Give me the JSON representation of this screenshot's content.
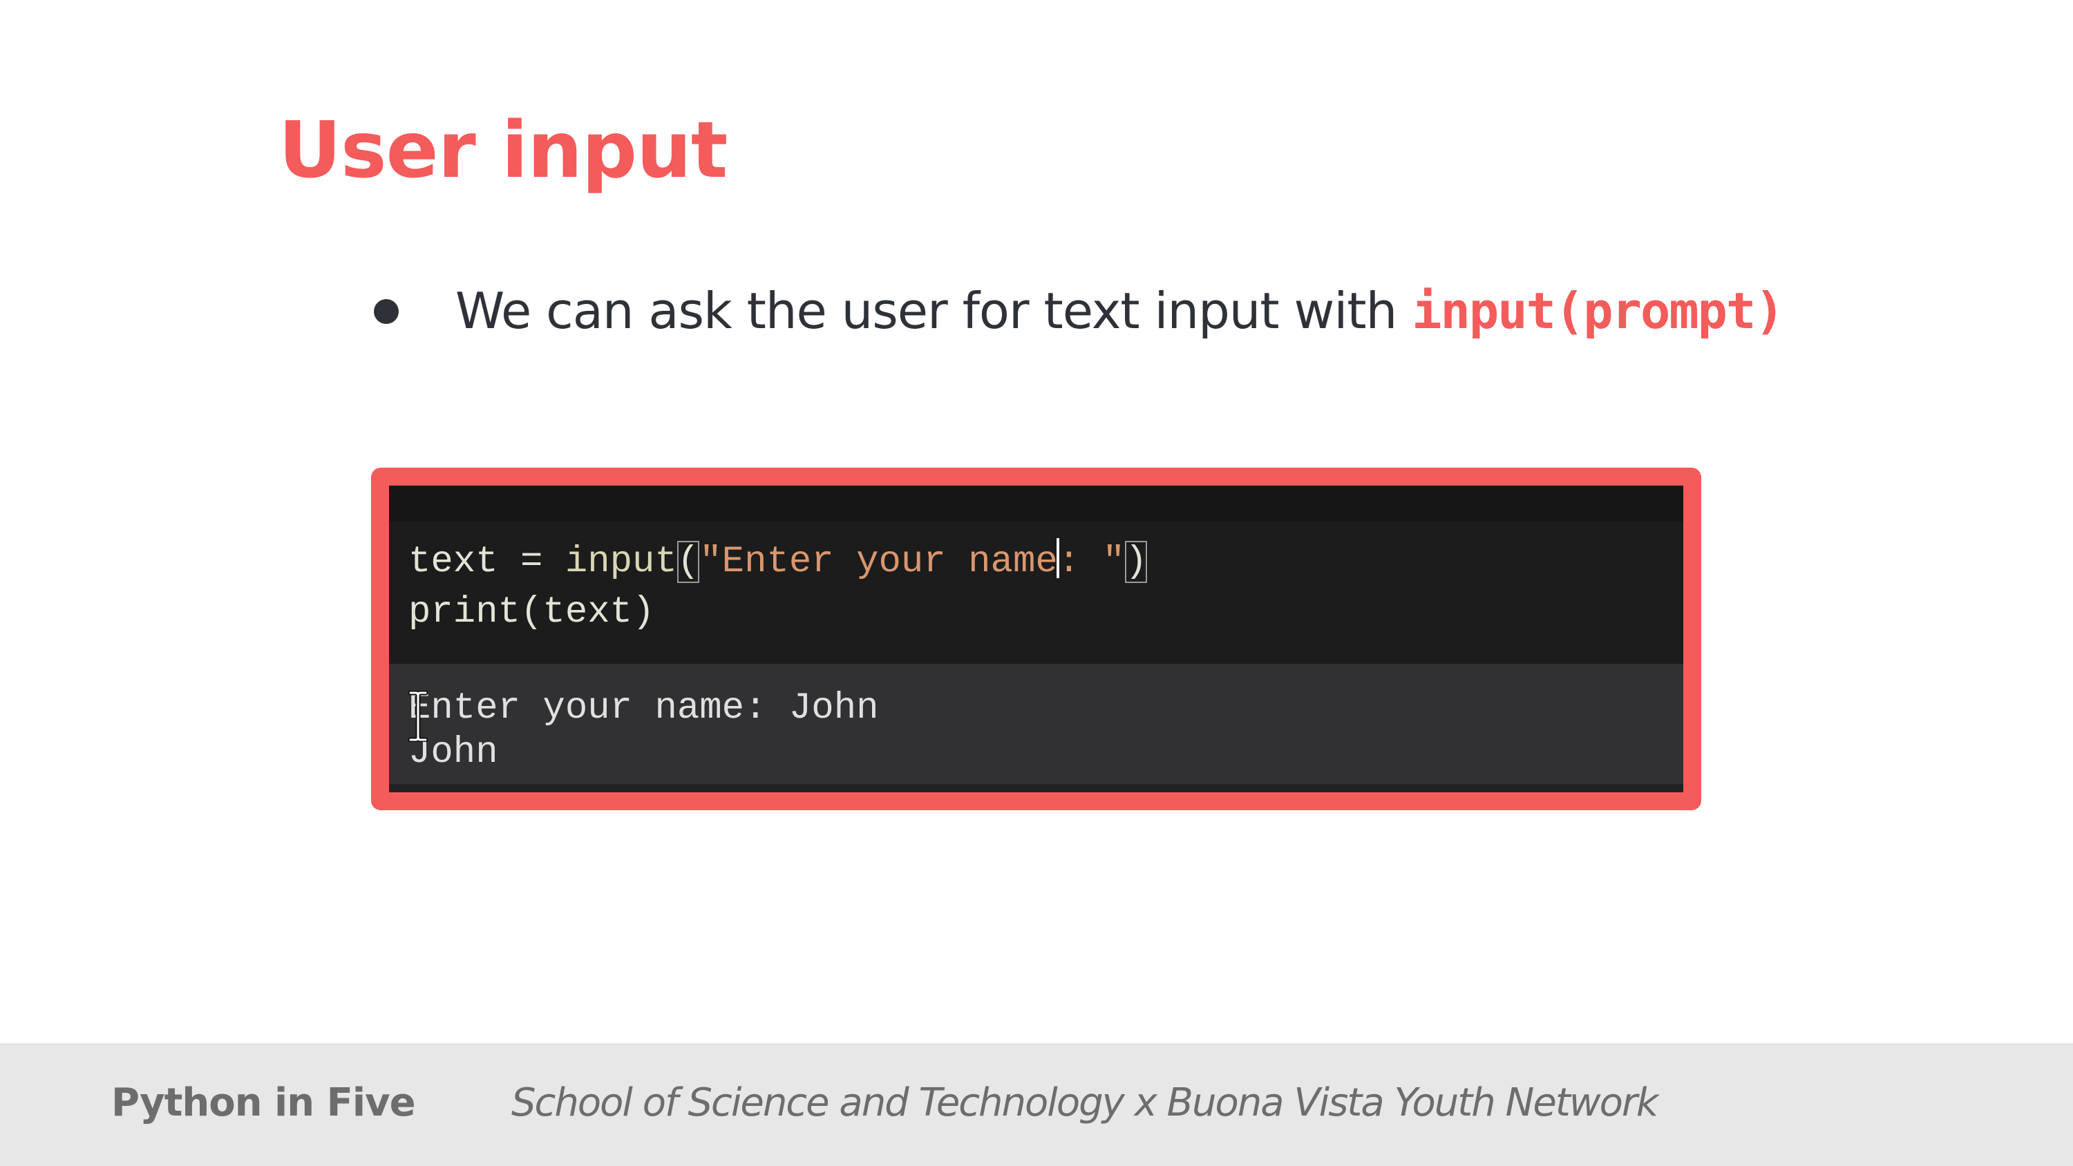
{
  "slide": {
    "title": "User input",
    "bullet": {
      "text": "We can ask the user for text input with ",
      "code": "input(prompt)"
    }
  },
  "code_screenshot": {
    "input_cell": {
      "line1": {
        "var": "text",
        "op": " = ",
        "fn": "input",
        "paren_open": "(",
        "str_part1": "\"Enter your name",
        "str_part2": ": \"",
        "paren_close": ")"
      },
      "line2": "print(text)"
    },
    "output_cell": {
      "line1": "Enter your name: John",
      "line2": "John"
    }
  },
  "footer": {
    "left": "Python in Five",
    "right": "School of Science and Technology x Buona Vista Youth Network"
  },
  "colors": {
    "accent": "#f45b5b",
    "body_text": "#2e3238",
    "footer_bg": "#e7e7e7",
    "footer_text": "#6d6d6d",
    "code_bg": "#1c1c1c",
    "output_bg": "#313134"
  }
}
